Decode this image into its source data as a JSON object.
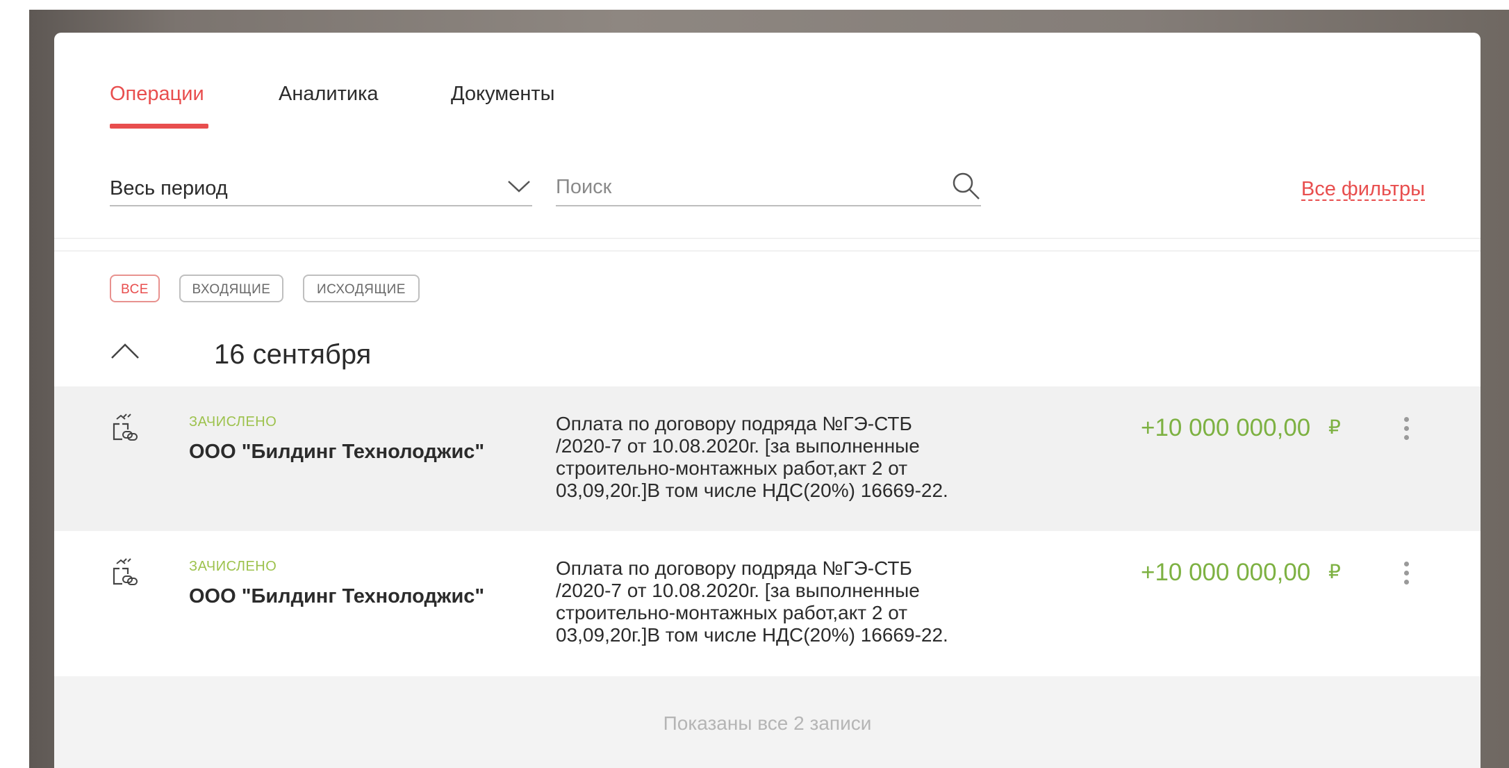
{
  "tabs": [
    {
      "label": "Операции",
      "active": true
    },
    {
      "label": "Аналитика",
      "active": false
    },
    {
      "label": "Документы",
      "active": false
    }
  ],
  "filters": {
    "period": "Весь период",
    "search_placeholder": "Поиск",
    "all_filters": "Все фильтры"
  },
  "chips": [
    {
      "label": "ВСЕ",
      "active": true
    },
    {
      "label": "ВХОДЯЩИЕ",
      "active": false
    },
    {
      "label": "ИСХОДЯЩИЕ",
      "active": false
    }
  ],
  "group": {
    "date": "16 сентября"
  },
  "operations": [
    {
      "status": "ЗАЧИСЛЕНО",
      "counterparty": "ООО \"Билдинг Технолоджис\"",
      "description": "Оплата по договору подряда №ГЭ-СТБ\n/2020-7 от 10.08.2020г. [за выполненные\nстроительно-монтажных работ,акт 2 от\n03,09,20г.]В том числе НДС(20%) 16669-22.",
      "amount": "+10 000 000,00",
      "currency": "₽"
    },
    {
      "status": "ЗАЧИСЛЕНО",
      "counterparty": "ООО \"Билдинг Технолоджис\"",
      "description": "Оплата по договору подряда №ГЭ-СТБ\n/2020-7 от 10.08.2020г. [за выполненные\nстроительно-монтажных работ,акт 2 от\n03,09,20г.]В том числе НДС(20%) 16669-22.",
      "amount": "+10 000 000,00",
      "currency": "₽"
    }
  ],
  "footer": {
    "text": "Показаны все 2 записи"
  },
  "colors": {
    "accent": "#e84e4e",
    "income": "#7db142",
    "status": "#9dc24d"
  },
  "icons": [
    "chevron-down-icon",
    "search-icon",
    "chevron-up-icon",
    "incoming-transfer-icon",
    "more-vertical-icon"
  ]
}
